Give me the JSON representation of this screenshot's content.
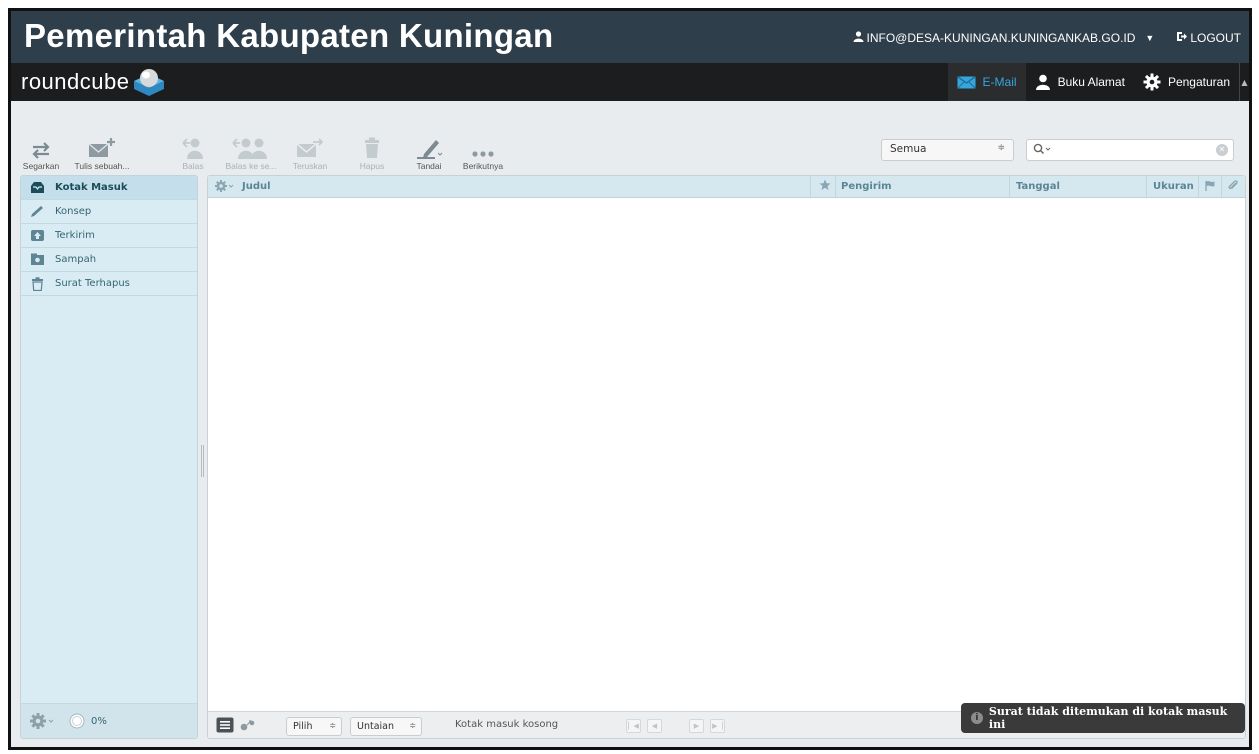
{
  "banner": {
    "title": "Pemerintah Kabupaten Kuningan",
    "user_email": "INFO@DESA-KUNINGAN.KUNINGANKAB.GO.ID",
    "logout_label": "LOGOUT"
  },
  "header": {
    "logo_text": "roundcube",
    "nav": [
      {
        "label": "E-Mail",
        "icon": "envelope-icon",
        "active": true
      },
      {
        "label": "Buku Alamat",
        "icon": "person-icon"
      },
      {
        "label": "Pengaturan",
        "icon": "gear-icon"
      }
    ]
  },
  "toolbar": {
    "buttons": [
      {
        "label": "Segarkan",
        "icon": "refresh-icon",
        "enabled": true
      },
      {
        "label": "Tulis sebuah...",
        "icon": "compose-icon",
        "enabled": true
      },
      {
        "label": "Balas",
        "icon": "reply-icon",
        "enabled": false
      },
      {
        "label": "Balas ke se...",
        "icon": "reply-all-icon",
        "enabled": false
      },
      {
        "label": "Teruskan",
        "icon": "forward-icon",
        "enabled": false
      },
      {
        "label": "Hapus",
        "icon": "trash-icon",
        "enabled": false
      },
      {
        "label": "Tandai",
        "icon": "mark-icon",
        "enabled": true
      },
      {
        "label": "Berikutnya",
        "icon": "more-icon",
        "enabled": true
      }
    ],
    "filter_value": "Semua",
    "search_placeholder": ""
  },
  "folders": [
    {
      "label": "Kotak Masuk",
      "icon": "inbox-icon",
      "selected": true
    },
    {
      "label": "Konsep",
      "icon": "pencil-icon"
    },
    {
      "label": "Terkirim",
      "icon": "sent-icon"
    },
    {
      "label": "Sampah",
      "icon": "junk-icon"
    },
    {
      "label": "Surat Terhapus",
      "icon": "trash-icon"
    }
  ],
  "quota": "0%",
  "list": {
    "columns": {
      "subject": "Judul",
      "from": "Pengirim",
      "date": "Tanggal",
      "size": "Ukuran"
    },
    "select_label": "Pilih",
    "threads_label": "Untaian",
    "status": "Kotak masuk kosong"
  },
  "notice": "Surat tidak ditemukan di kotak masuk ini",
  "colors": {
    "banner_bg": "#2e3e4a",
    "header_bg": "#1b1d1e",
    "accent": "#36a7dd",
    "folder_bg": "#d9ecf4"
  }
}
